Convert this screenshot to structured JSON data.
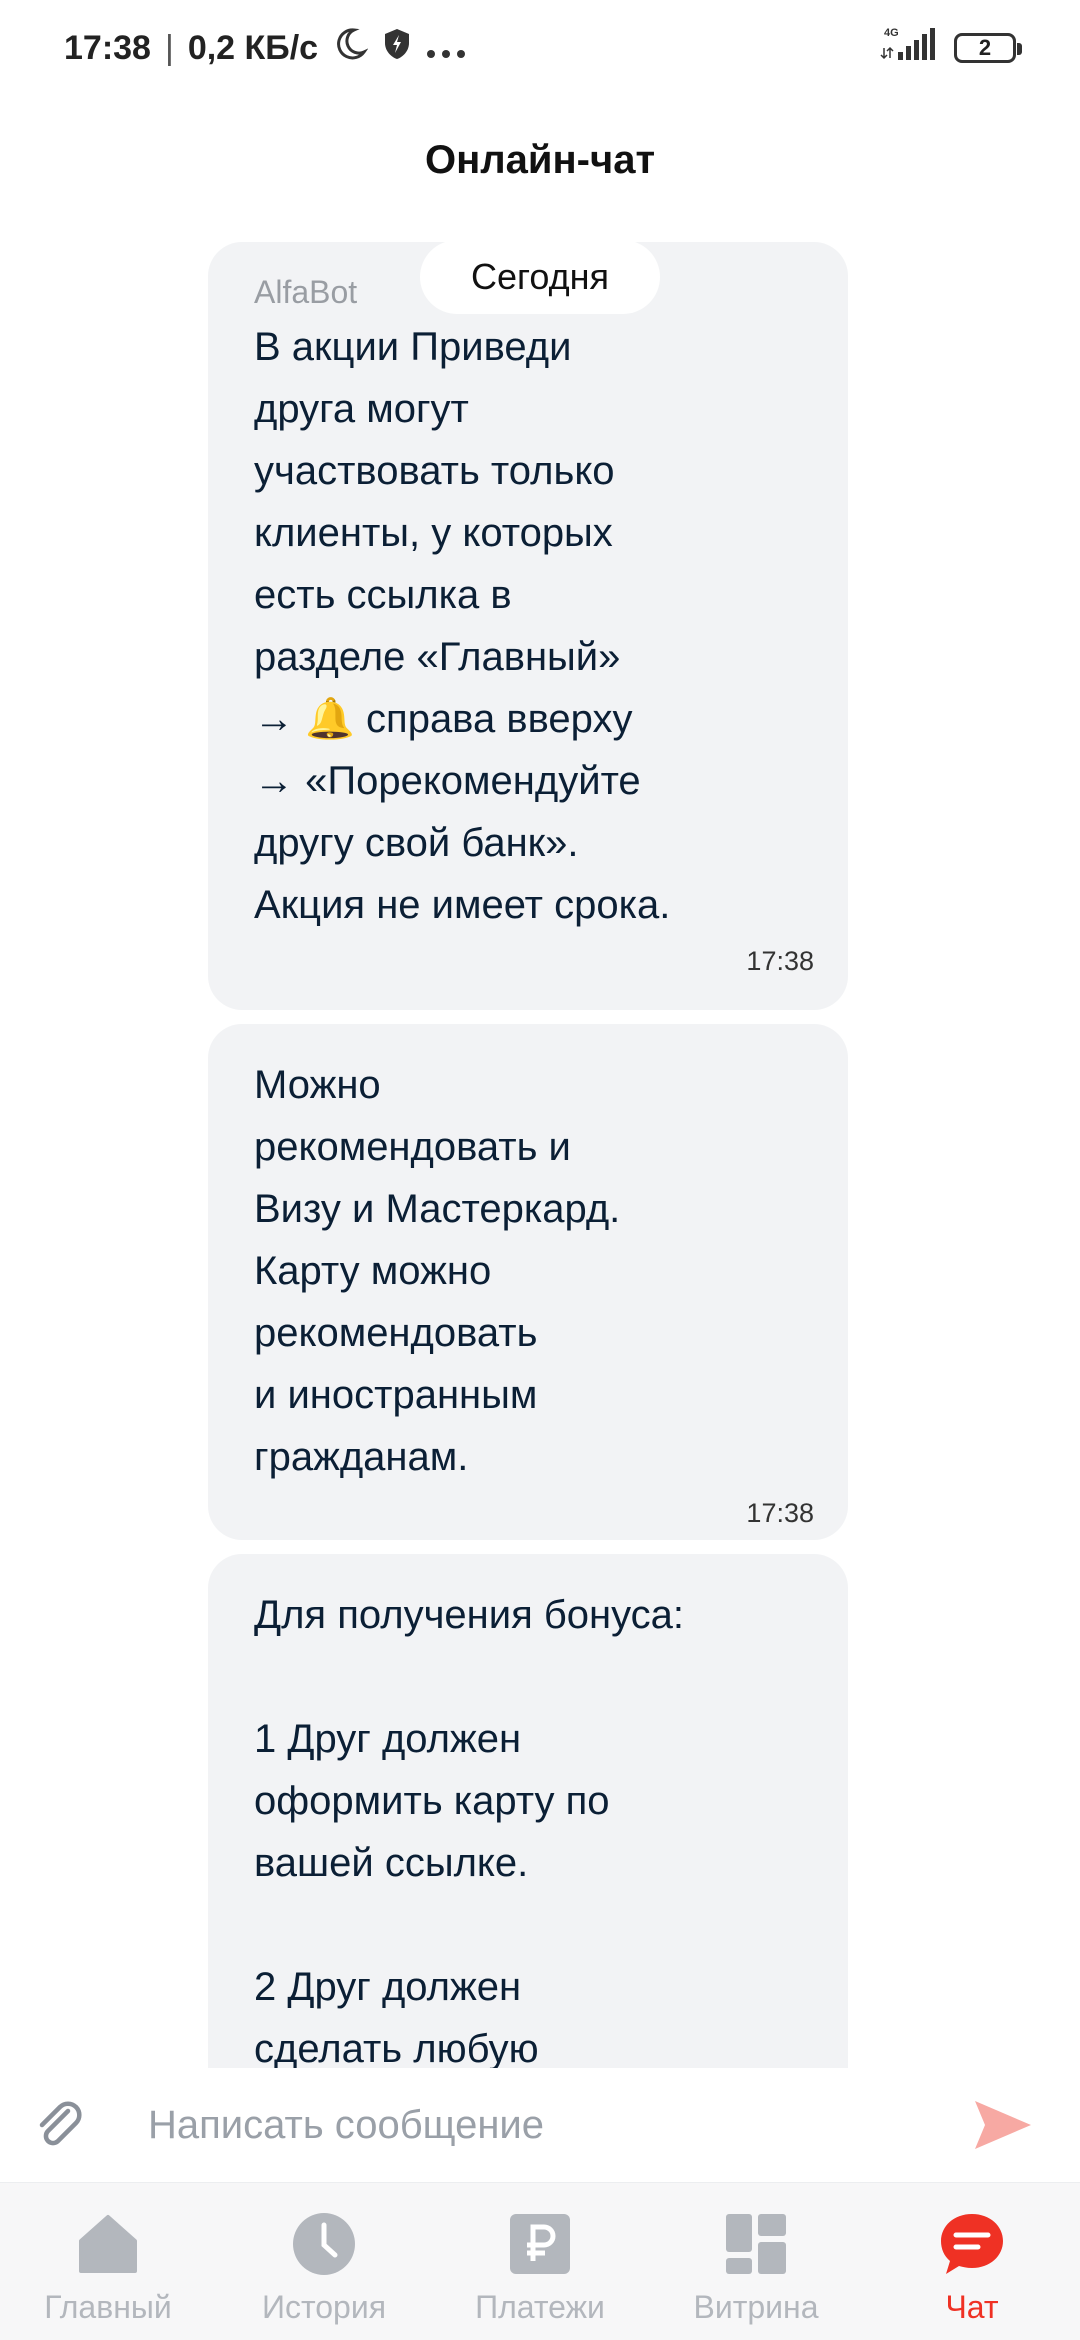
{
  "status_bar": {
    "time": "17:38",
    "speed": "0,2 КБ/с",
    "network": "4G",
    "battery": "2"
  },
  "header": {
    "title": "Онлайн-чат"
  },
  "chat": {
    "date_label": "Сегодня",
    "messages": [
      {
        "sender": "AlfaBot",
        "text": "В акции Приведи\nдруга могут\nучаствовать только\nклиенты, у которых\nесть ссылка в\nразделе «Главный»\n→ 🔔 справа вверху\n→ «Порекомендуйте\nдругу свой банк».\nАкция не имеет срока.",
        "time": "17:38"
      },
      {
        "text": "Можно\nрекомендовать и\nВизу и Мастеркард.\nКарту можно\nрекомендовать\nи иностранным\nгражданам.",
        "time": "17:38"
      },
      {
        "text": "Для получения бонуса:\n\n1 Друг должен\nоформить карту по\nвашей ссылке.\n\n2 Друг должен\nсделать любую"
      }
    ]
  },
  "input": {
    "placeholder": "Написать сообщение"
  },
  "nav": {
    "items": [
      {
        "label": "Главный",
        "icon": "home-icon"
      },
      {
        "label": "История",
        "icon": "clock-icon"
      },
      {
        "label": "Платежи",
        "icon": "ruble-icon"
      },
      {
        "label": "Витрина",
        "icon": "grid-icon"
      },
      {
        "label": "Чат",
        "icon": "chat-icon",
        "active": true
      }
    ]
  },
  "colors": {
    "accent": "#ef3124",
    "bubble_bg": "#f2f3f5",
    "nav_inactive": "#b3b7bd",
    "send_icon": "#f7a9a3"
  }
}
